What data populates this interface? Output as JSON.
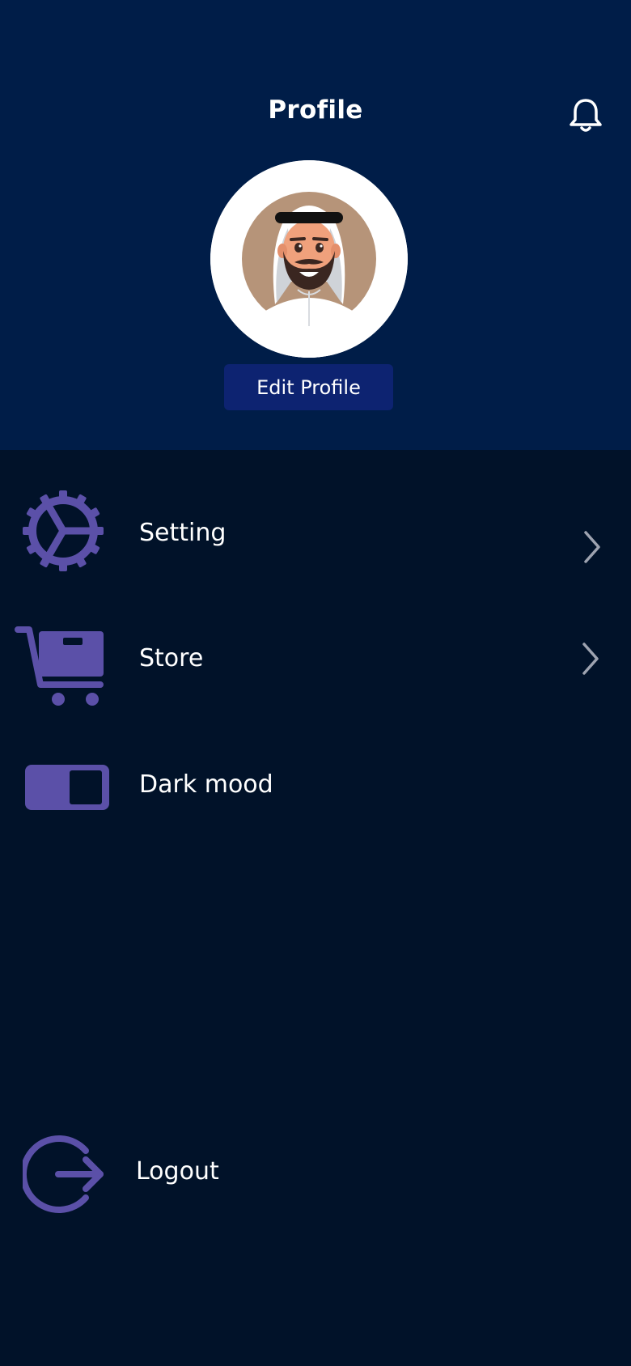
{
  "header": {
    "title": "Profile",
    "notification_icon": "bell-icon",
    "edit_profile_label": "Edit Profile",
    "avatar": "avatar-man-with-ghutra"
  },
  "menu": {
    "items": [
      {
        "label": "Setting",
        "icon": "gear-icon",
        "trailing": "chevron-right-icon"
      },
      {
        "label": "Store",
        "icon": "cart-icon",
        "trailing": "chevron-right-icon"
      },
      {
        "label": "Dark mood",
        "icon": "toggle-icon",
        "toggle_on": false
      }
    ],
    "logout_label": "Logout",
    "logout_icon": "logout-icon"
  },
  "colors": {
    "header_bg": "#001d48",
    "body_bg": "#011229",
    "accent": "#5b50a8",
    "button_bg": "#0d2371",
    "chevron": "#9ea3b0"
  }
}
